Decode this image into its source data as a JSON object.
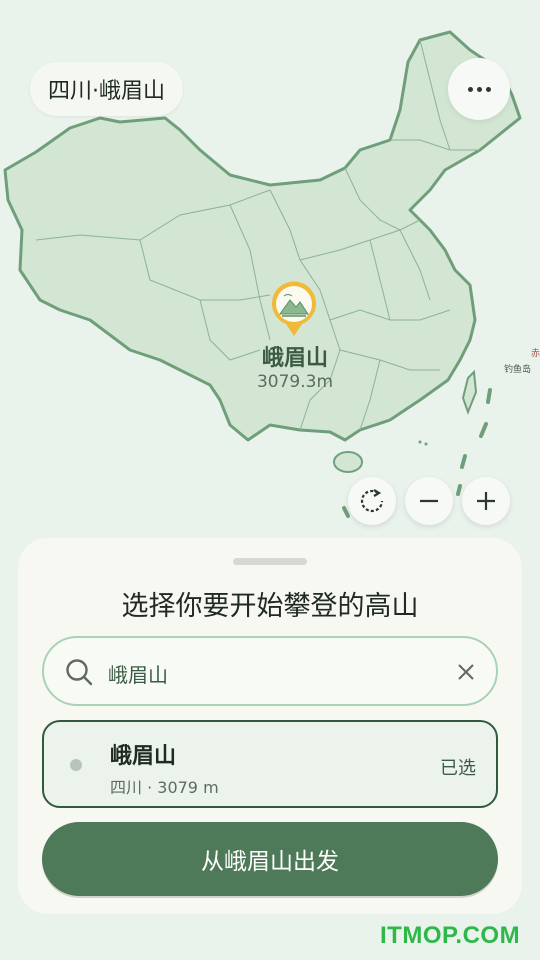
{
  "header": {
    "location_label": "四川·峨眉山"
  },
  "map": {
    "selected_mountain": {
      "name": "峨眉山",
      "height_label": "3079.3m"
    },
    "island_label": "钓鱼岛",
    "island_label_partial": "赤",
    "controls": {
      "reset_icon": "rotate-icon",
      "zoom_out_icon": "minus-icon",
      "zoom_in_icon": "plus-icon"
    }
  },
  "sheet": {
    "title": "选择你要开始攀登的高山",
    "search": {
      "value": "峨眉山"
    },
    "result": {
      "name": "峨眉山",
      "meta": "四川 · 3079 m",
      "status": "已选"
    },
    "start_button_label": "从峨眉山出发"
  },
  "watermark": "ITMOP.COM",
  "colors": {
    "accent": "#4e7a59",
    "map_fill": "#d3e6d3",
    "map_border": "#6f9f7a",
    "pin": "#f0b93a"
  }
}
